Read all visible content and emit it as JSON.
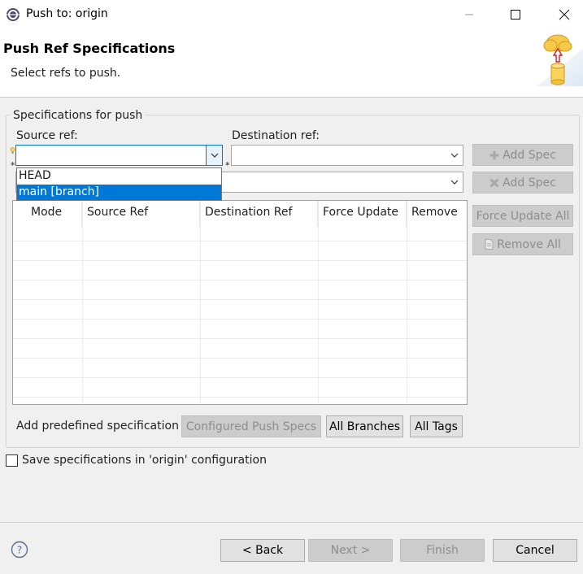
{
  "window": {
    "title": "Push to: origin"
  },
  "header": {
    "title": "Push Ref Specifications",
    "description": "Select refs to push."
  },
  "group": {
    "label": "Specifications for push",
    "source_label": "Source ref:",
    "destination_label": "Destination ref:",
    "source_value": "",
    "destination_value": "",
    "second_value": "",
    "required_marker": "*",
    "add_spec_label": "Add Spec",
    "add_delete_spec_label": "Add Spec",
    "force_update_all_label": "Force Update All",
    "remove_all_label": "Remove All"
  },
  "dropdown": {
    "items": [
      "HEAD",
      "main [branch]"
    ],
    "selected_index": 1
  },
  "table": {
    "columns": [
      "Mode",
      "Source Ref",
      "Destination Ref",
      "Force Update",
      "Remove"
    ],
    "rows": []
  },
  "predefined": {
    "label": "Add predefined specification",
    "configured_label": "Configured Push Specs",
    "all_branches_label": "All Branches",
    "all_tags_label": "All Tags"
  },
  "save_config": {
    "label": "Save specifications in 'origin' configuration",
    "checked": false
  },
  "footer": {
    "back_label": "< Back",
    "next_label": "Next >",
    "finish_label": "Finish",
    "cancel_label": "Cancel"
  },
  "colors": {
    "accent": "#0078d7",
    "disabled_button": "#cccccc",
    "disabled_text": "#8d8d8d"
  }
}
